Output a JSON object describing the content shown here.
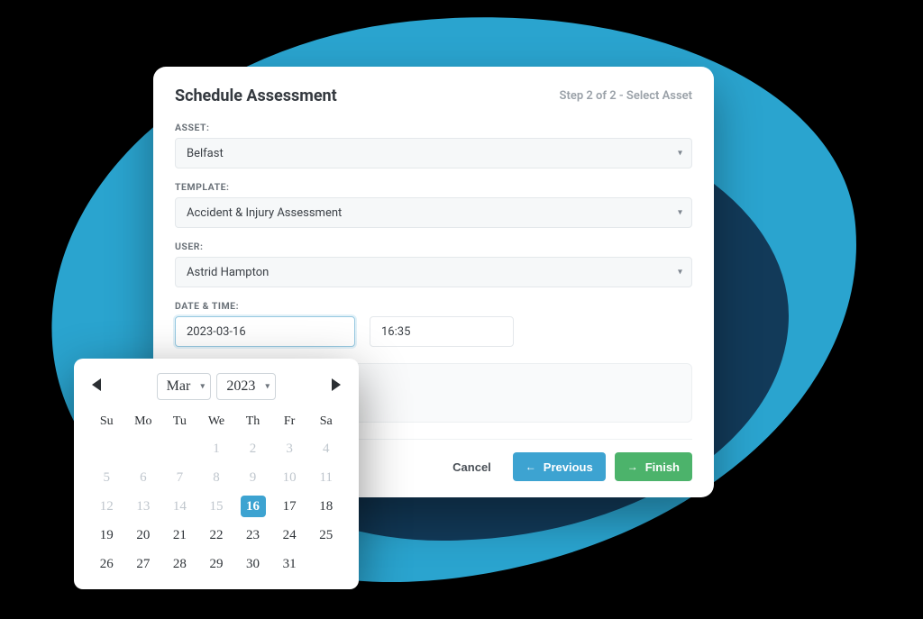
{
  "modal": {
    "title": "Schedule Assessment",
    "step": "Step 2 of 2 - Select Asset",
    "fields": {
      "asset_label": "ASSET:",
      "asset_value": "Belfast",
      "template_label": "TEMPLATE:",
      "template_value": "Accident & Injury Assessment",
      "user_label": "USER:",
      "user_value": "Astrid Hampton",
      "datetime_label": "DATE & TIME:",
      "date_value": "2023-03-16",
      "time_value": "16:35"
    },
    "footer": {
      "cancel": "Cancel",
      "previous": "Previous",
      "finish": "Finish"
    }
  },
  "datepicker": {
    "month": "Mar",
    "year": "2023",
    "weekdays": [
      "Su",
      "Mo",
      "Tu",
      "We",
      "Th",
      "Fr",
      "Sa"
    ],
    "rows": [
      [
        {
          "d": ""
        },
        {
          "d": ""
        },
        {
          "d": ""
        },
        {
          "d": "1",
          "m": true
        },
        {
          "d": "2",
          "m": true
        },
        {
          "d": "3",
          "m": true
        },
        {
          "d": "4",
          "m": true
        }
      ],
      [
        {
          "d": "5",
          "m": true
        },
        {
          "d": "6",
          "m": true
        },
        {
          "d": "7",
          "m": true
        },
        {
          "d": "8",
          "m": true
        },
        {
          "d": "9",
          "m": true
        },
        {
          "d": "10",
          "m": true
        },
        {
          "d": "11",
          "m": true
        }
      ],
      [
        {
          "d": "12",
          "m": true
        },
        {
          "d": "13",
          "m": true
        },
        {
          "d": "14",
          "m": true
        },
        {
          "d": "15",
          "m": true
        },
        {
          "d": "16",
          "s": true
        },
        {
          "d": "17"
        },
        {
          "d": "18"
        }
      ],
      [
        {
          "d": "19"
        },
        {
          "d": "20"
        },
        {
          "d": "21"
        },
        {
          "d": "22"
        },
        {
          "d": "23"
        },
        {
          "d": "24"
        },
        {
          "d": "25"
        }
      ],
      [
        {
          "d": "26"
        },
        {
          "d": "27"
        },
        {
          "d": "28"
        },
        {
          "d": "29"
        },
        {
          "d": "30"
        },
        {
          "d": "31"
        },
        {
          "d": ""
        }
      ]
    ]
  }
}
